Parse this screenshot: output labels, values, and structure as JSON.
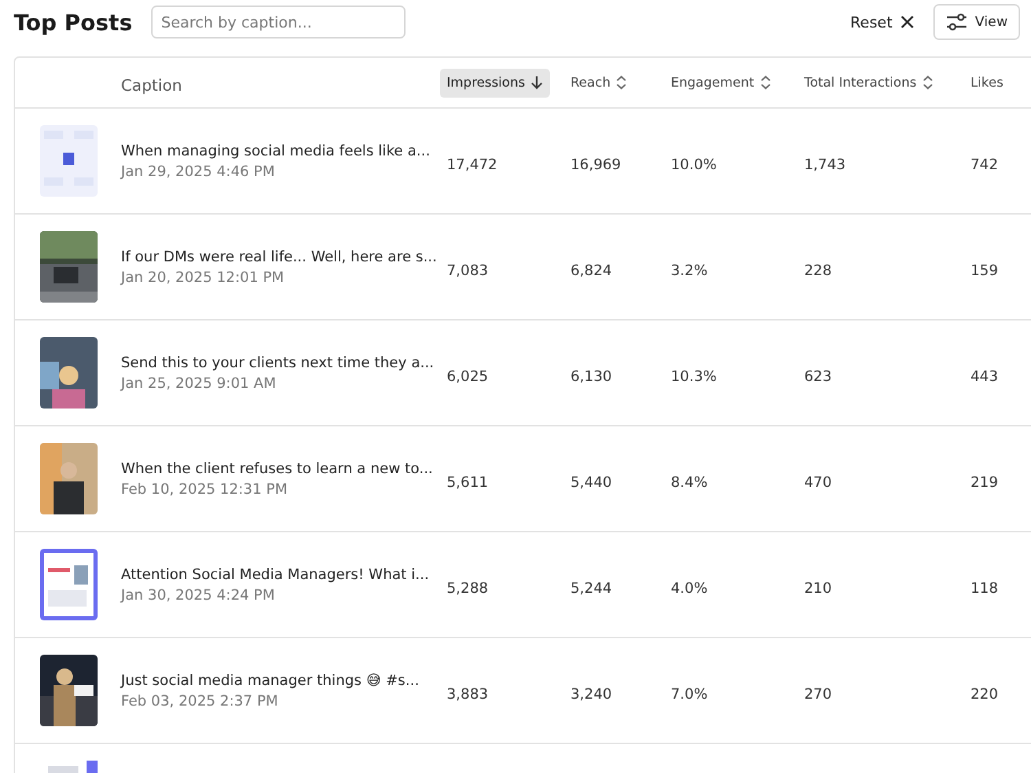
{
  "title": "Top Posts",
  "search": {
    "placeholder": "Search by caption..."
  },
  "reset_button": {
    "label": "Reset"
  },
  "view_button": {
    "label": "View"
  },
  "columns": [
    {
      "label": "Caption",
      "kind": "plain"
    },
    {
      "label": "Impressions",
      "kind": "sorted_desc",
      "selected": true
    },
    {
      "label": "Reach",
      "kind": "sortable",
      "selected": false
    },
    {
      "label": "Engagement",
      "kind": "sortable",
      "selected": false
    },
    {
      "label": "Total Interactions",
      "kind": "sortable",
      "selected": false
    },
    {
      "label": "Likes",
      "kind": "cut",
      "selected": false
    }
  ],
  "rows": [
    {
      "caption": "When managing social media feels like a...",
      "date": "Jan 29, 2025 4:46 PM",
      "impressions": "17,472",
      "reach": "16,969",
      "engagement": "10.0%",
      "total_interactions": "1,743",
      "likes": "742"
    },
    {
      "caption": "If our DMs were real life... Well, here are s...",
      "date": "Jan 20, 2025 12:01 PM",
      "impressions": "7,083",
      "reach": "6,824",
      "engagement": "3.2%",
      "total_interactions": "228",
      "likes": "159"
    },
    {
      "caption": "Send this to your clients next time they a...",
      "date": "Jan 25, 2025 9:01 AM",
      "impressions": "6,025",
      "reach": "6,130",
      "engagement": "10.3%",
      "total_interactions": "623",
      "likes": "443"
    },
    {
      "caption": "When the client refuses to learn a new to...",
      "date": "Feb 10, 2025 12:31 PM",
      "impressions": "5,611",
      "reach": "5,440",
      "engagement": "8.4%",
      "total_interactions": "470",
      "likes": "219"
    },
    {
      "caption": "Attention Social Media Managers! What i...",
      "date": "Jan 30, 2025 4:24 PM",
      "impressions": "5,288",
      "reach": "5,244",
      "engagement": "4.0%",
      "total_interactions": "210",
      "likes": "118"
    },
    {
      "caption": "Just social media manager things 😅 #s...",
      "date": "Feb 03, 2025 2:37 PM",
      "impressions": "3,883",
      "reach": "3,240",
      "engagement": "7.0%",
      "total_interactions": "270",
      "likes": "220"
    }
  ]
}
